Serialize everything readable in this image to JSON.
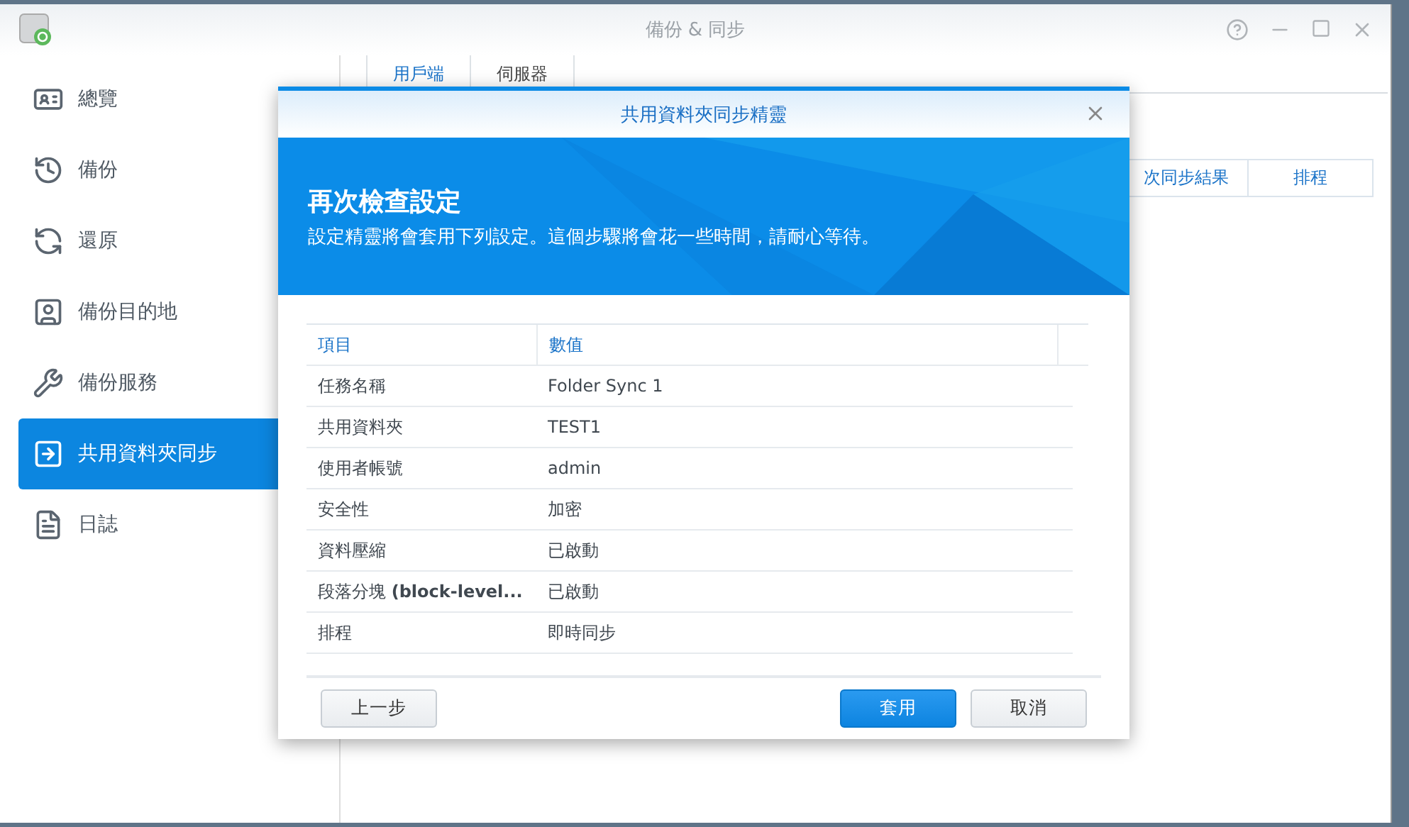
{
  "window": {
    "title": "備份 & 同步"
  },
  "sidebar": {
    "items": [
      {
        "label": "總覽",
        "kind": "overview",
        "selected": false
      },
      {
        "label": "備份",
        "kind": "backup",
        "selected": false
      },
      {
        "label": "還原",
        "kind": "restore",
        "selected": false
      },
      {
        "label": "備份目的地",
        "kind": "destination",
        "selected": false
      },
      {
        "label": "備份服務",
        "kind": "service",
        "selected": false
      },
      {
        "label": "共用資料夾同步",
        "kind": "sync",
        "selected": true
      },
      {
        "label": "日誌",
        "kind": "log",
        "selected": false
      }
    ]
  },
  "tabs": [
    {
      "label": "用戶端",
      "selected": true
    },
    {
      "label": "伺服器",
      "selected": false
    }
  ],
  "table": {
    "columns": [
      "次同步結果",
      "排程"
    ]
  },
  "dialog": {
    "title": "共用資料夾同步精靈",
    "heading": "再次檢查設定",
    "description": "設定精靈將會套用下列設定。這個步驟將會花一些時間，請耐心等待。",
    "columns": [
      "項目",
      "數值"
    ],
    "rows": [
      {
        "item": "任務名稱",
        "value": "Folder Sync 1"
      },
      {
        "item": "共用資料夾",
        "value": "TEST1"
      },
      {
        "item": "使用者帳號",
        "value": "admin"
      },
      {
        "item": "安全性",
        "value": "加密"
      },
      {
        "item": "資料壓縮",
        "value": "已啟動"
      },
      {
        "item": "段落分塊 **(block-level...**",
        "value": "已啟動"
      },
      {
        "item": "排程",
        "value": "即時同步"
      }
    ],
    "buttons": [
      {
        "label": "上一步",
        "kind": "back"
      },
      {
        "label": "套用",
        "kind": "primary"
      },
      {
        "label": "取消",
        "kind": "secondary"
      }
    ]
  }
}
